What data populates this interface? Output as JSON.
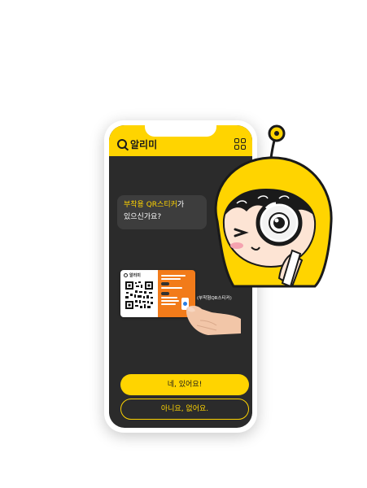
{
  "app": {
    "brand_name": "알리미"
  },
  "header": {
    "menu_icon": "qr-grid-icon"
  },
  "chat": {
    "highlight": "부착용 QR스티커",
    "text_rest_line1": "가",
    "text_line2": "있으신가요?"
  },
  "sticker": {
    "brand_name": "알리미",
    "caption": "(부착형QR스티커)"
  },
  "buttons": {
    "yes_label": "네, 있어요!",
    "no_label": "아니요, 없어요."
  },
  "colors": {
    "accent": "#ffd400",
    "screen_bg": "#2b2b2b",
    "bubble_bg": "#3d3d3d",
    "sticker_orange": "#f27b1a"
  }
}
